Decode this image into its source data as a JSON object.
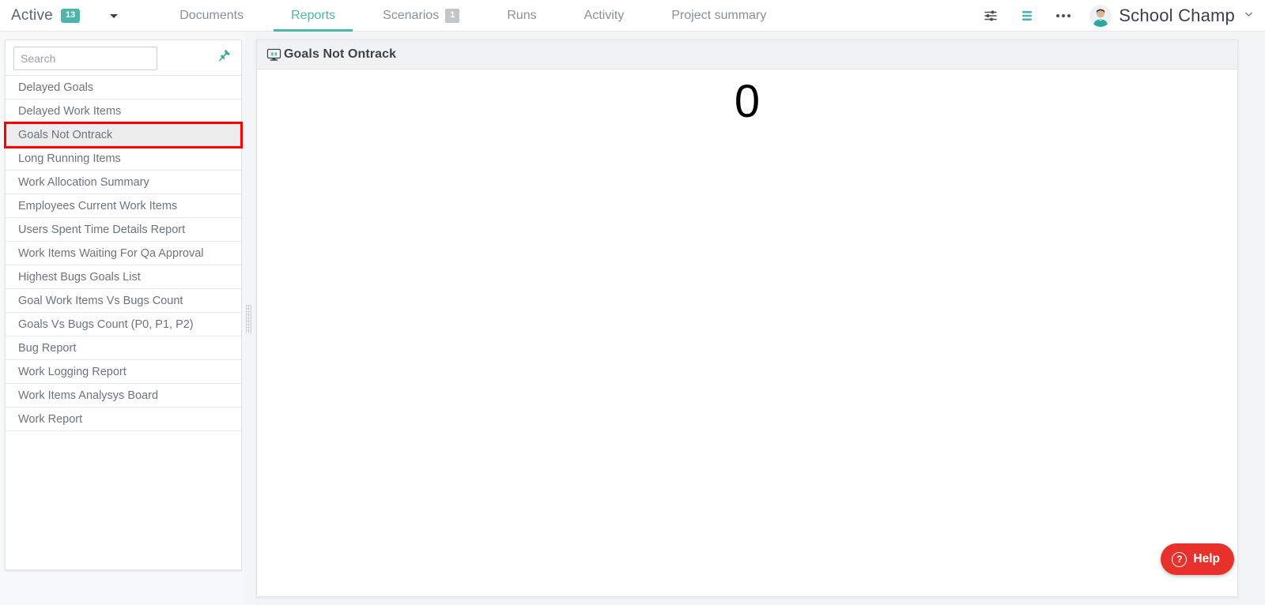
{
  "topbar": {
    "active_label": "Active",
    "active_count": "13",
    "caret_icon": "chevron-down-icon",
    "tabs": [
      {
        "label": "Documents",
        "active": false,
        "badge": ""
      },
      {
        "label": "Reports",
        "active": true,
        "badge": ""
      },
      {
        "label": "Scenarios",
        "active": false,
        "badge": "1"
      },
      {
        "label": "Runs",
        "active": false,
        "badge": ""
      },
      {
        "label": "Activity",
        "active": false,
        "badge": ""
      },
      {
        "label": "Project summary",
        "active": false,
        "badge": ""
      }
    ],
    "filters_icon": "sliders-icon",
    "list_icon": "list-lines-icon",
    "more_icon": "more-horizontal-icon",
    "avatar_icon": "user-avatar",
    "username": "School Champ",
    "user_caret_icon": "chevron-down-icon"
  },
  "sidebar": {
    "search_placeholder": "Search",
    "search_value": "",
    "pin_icon": "pushpin-icon",
    "items": [
      {
        "label": "Delayed Goals",
        "selected": false
      },
      {
        "label": "Delayed Work Items",
        "selected": false
      },
      {
        "label": "Goals Not Ontrack",
        "selected": true
      },
      {
        "label": "Long Running Items",
        "selected": false
      },
      {
        "label": "Work Allocation Summary",
        "selected": false
      },
      {
        "label": "Employees Current Work Items",
        "selected": false
      },
      {
        "label": "Users Spent Time Details Report",
        "selected": false
      },
      {
        "label": "Work Items Waiting For Qa Approval",
        "selected": false
      },
      {
        "label": "Highest Bugs Goals List",
        "selected": false
      },
      {
        "label": "Goal Work Items Vs Bugs Count",
        "selected": false
      },
      {
        "label": "Goals Vs Bugs Count (P0, P1, P2)",
        "selected": false
      },
      {
        "label": "Bug Report",
        "selected": false
      },
      {
        "label": "Work Logging Report",
        "selected": false
      },
      {
        "label": "Work Items Analysys Board",
        "selected": false
      },
      {
        "label": "Work Report",
        "selected": false
      }
    ],
    "splitter_icon": "drag-handle-icon"
  },
  "content": {
    "card_icon": "monitor-report-icon",
    "card_title": "Goals Not Ontrack",
    "value": "0"
  },
  "help": {
    "icon": "question-mark-icon",
    "label": "Help"
  },
  "colors": {
    "accent_teal": "#4db6ac",
    "help_red": "#e8312a",
    "selection_outline": "#ff0000",
    "badge_gray": "#c3c7cb"
  }
}
